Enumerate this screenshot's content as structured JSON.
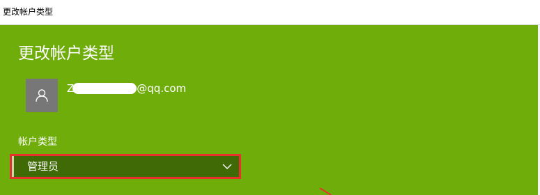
{
  "window": {
    "title": "更改帐户类型"
  },
  "page": {
    "title": "更改帐户类型"
  },
  "account": {
    "email_prefix": "Z",
    "email_suffix": "@qq.com",
    "avatar_icon": "user-icon"
  },
  "account_type": {
    "label": "帐户类型",
    "selected": "管理员",
    "chevron_icon": "chevron-down-icon"
  },
  "colors": {
    "background": "#6fad0a",
    "select_background": "#3f6a06",
    "highlight_border": "#e8312c",
    "avatar_background": "#777777"
  }
}
